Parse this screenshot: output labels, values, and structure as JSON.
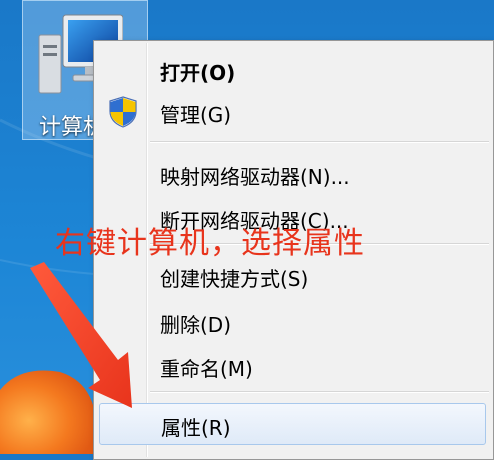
{
  "desktop": {
    "computer_icon_label": "计算机"
  },
  "context_menu": {
    "items": [
      {
        "label": "打开(O)"
      },
      {
        "label": "管理(G)"
      },
      {
        "label": "映射网络驱动器(N)..."
      },
      {
        "label": "断开网络驱动器(C)..."
      },
      {
        "label": "创建快捷方式(S)"
      },
      {
        "label": "删除(D)"
      },
      {
        "label": "重命名(M)"
      },
      {
        "label": "属性(R)"
      }
    ],
    "highlighted_item": "属性(R)"
  },
  "annotation": {
    "text": "右键计算机，选择属性",
    "color": "#e8341c"
  },
  "icons": {
    "computer": "computer-icon",
    "shield": "uac-shield-icon",
    "arrow": "red-arrow-icon"
  }
}
